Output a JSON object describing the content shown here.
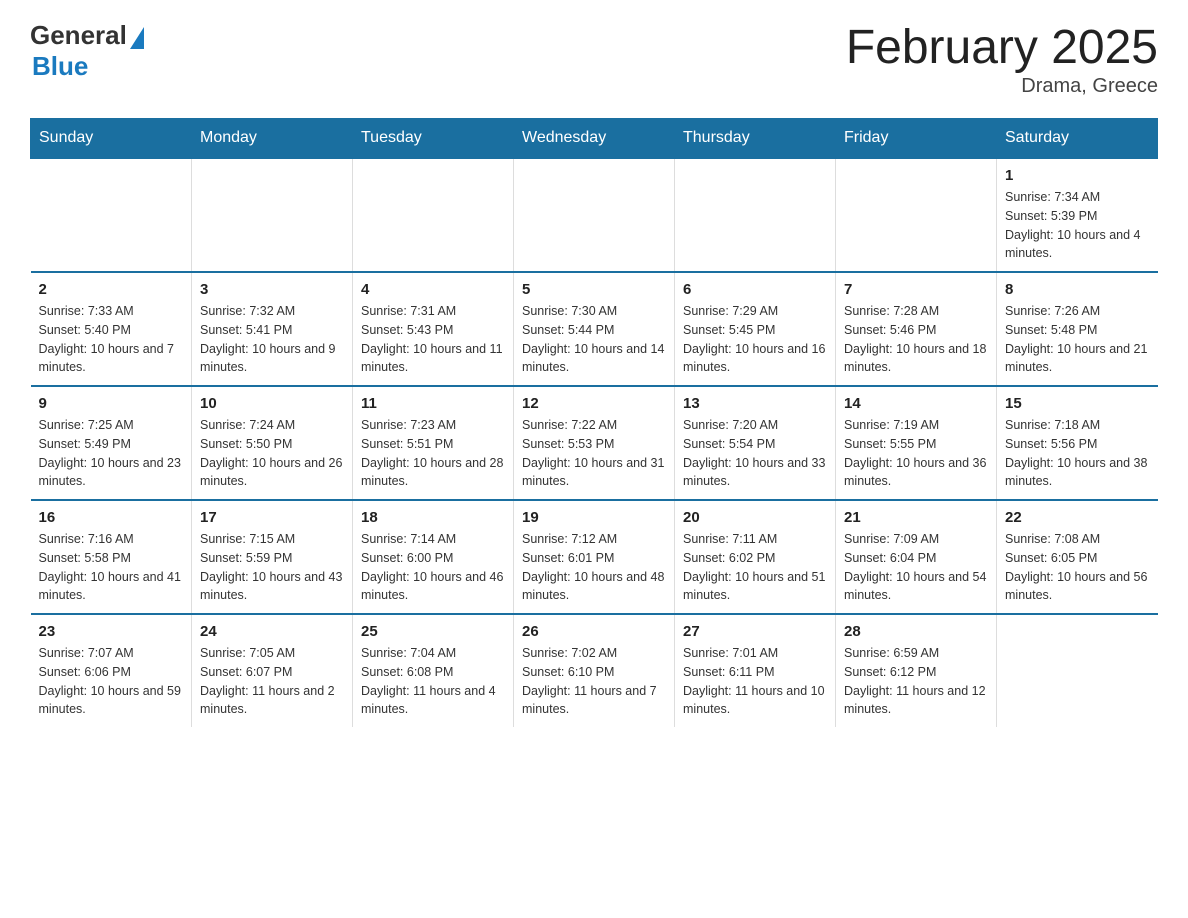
{
  "header": {
    "logo_general": "General",
    "logo_blue": "Blue",
    "title": "February 2025",
    "location": "Drama, Greece"
  },
  "weekdays": [
    "Sunday",
    "Monday",
    "Tuesday",
    "Wednesday",
    "Thursday",
    "Friday",
    "Saturday"
  ],
  "weeks": [
    [
      {
        "day": "",
        "info": ""
      },
      {
        "day": "",
        "info": ""
      },
      {
        "day": "",
        "info": ""
      },
      {
        "day": "",
        "info": ""
      },
      {
        "day": "",
        "info": ""
      },
      {
        "day": "",
        "info": ""
      },
      {
        "day": "1",
        "info": "Sunrise: 7:34 AM\nSunset: 5:39 PM\nDaylight: 10 hours and 4 minutes."
      }
    ],
    [
      {
        "day": "2",
        "info": "Sunrise: 7:33 AM\nSunset: 5:40 PM\nDaylight: 10 hours and 7 minutes."
      },
      {
        "day": "3",
        "info": "Sunrise: 7:32 AM\nSunset: 5:41 PM\nDaylight: 10 hours and 9 minutes."
      },
      {
        "day": "4",
        "info": "Sunrise: 7:31 AM\nSunset: 5:43 PM\nDaylight: 10 hours and 11 minutes."
      },
      {
        "day": "5",
        "info": "Sunrise: 7:30 AM\nSunset: 5:44 PM\nDaylight: 10 hours and 14 minutes."
      },
      {
        "day": "6",
        "info": "Sunrise: 7:29 AM\nSunset: 5:45 PM\nDaylight: 10 hours and 16 minutes."
      },
      {
        "day": "7",
        "info": "Sunrise: 7:28 AM\nSunset: 5:46 PM\nDaylight: 10 hours and 18 minutes."
      },
      {
        "day": "8",
        "info": "Sunrise: 7:26 AM\nSunset: 5:48 PM\nDaylight: 10 hours and 21 minutes."
      }
    ],
    [
      {
        "day": "9",
        "info": "Sunrise: 7:25 AM\nSunset: 5:49 PM\nDaylight: 10 hours and 23 minutes."
      },
      {
        "day": "10",
        "info": "Sunrise: 7:24 AM\nSunset: 5:50 PM\nDaylight: 10 hours and 26 minutes."
      },
      {
        "day": "11",
        "info": "Sunrise: 7:23 AM\nSunset: 5:51 PM\nDaylight: 10 hours and 28 minutes."
      },
      {
        "day": "12",
        "info": "Sunrise: 7:22 AM\nSunset: 5:53 PM\nDaylight: 10 hours and 31 minutes."
      },
      {
        "day": "13",
        "info": "Sunrise: 7:20 AM\nSunset: 5:54 PM\nDaylight: 10 hours and 33 minutes."
      },
      {
        "day": "14",
        "info": "Sunrise: 7:19 AM\nSunset: 5:55 PM\nDaylight: 10 hours and 36 minutes."
      },
      {
        "day": "15",
        "info": "Sunrise: 7:18 AM\nSunset: 5:56 PM\nDaylight: 10 hours and 38 minutes."
      }
    ],
    [
      {
        "day": "16",
        "info": "Sunrise: 7:16 AM\nSunset: 5:58 PM\nDaylight: 10 hours and 41 minutes."
      },
      {
        "day": "17",
        "info": "Sunrise: 7:15 AM\nSunset: 5:59 PM\nDaylight: 10 hours and 43 minutes."
      },
      {
        "day": "18",
        "info": "Sunrise: 7:14 AM\nSunset: 6:00 PM\nDaylight: 10 hours and 46 minutes."
      },
      {
        "day": "19",
        "info": "Sunrise: 7:12 AM\nSunset: 6:01 PM\nDaylight: 10 hours and 48 minutes."
      },
      {
        "day": "20",
        "info": "Sunrise: 7:11 AM\nSunset: 6:02 PM\nDaylight: 10 hours and 51 minutes."
      },
      {
        "day": "21",
        "info": "Sunrise: 7:09 AM\nSunset: 6:04 PM\nDaylight: 10 hours and 54 minutes."
      },
      {
        "day": "22",
        "info": "Sunrise: 7:08 AM\nSunset: 6:05 PM\nDaylight: 10 hours and 56 minutes."
      }
    ],
    [
      {
        "day": "23",
        "info": "Sunrise: 7:07 AM\nSunset: 6:06 PM\nDaylight: 10 hours and 59 minutes."
      },
      {
        "day": "24",
        "info": "Sunrise: 7:05 AM\nSunset: 6:07 PM\nDaylight: 11 hours and 2 minutes."
      },
      {
        "day": "25",
        "info": "Sunrise: 7:04 AM\nSunset: 6:08 PM\nDaylight: 11 hours and 4 minutes."
      },
      {
        "day": "26",
        "info": "Sunrise: 7:02 AM\nSunset: 6:10 PM\nDaylight: 11 hours and 7 minutes."
      },
      {
        "day": "27",
        "info": "Sunrise: 7:01 AM\nSunset: 6:11 PM\nDaylight: 11 hours and 10 minutes."
      },
      {
        "day": "28",
        "info": "Sunrise: 6:59 AM\nSunset: 6:12 PM\nDaylight: 11 hours and 12 minutes."
      },
      {
        "day": "",
        "info": ""
      }
    ]
  ]
}
